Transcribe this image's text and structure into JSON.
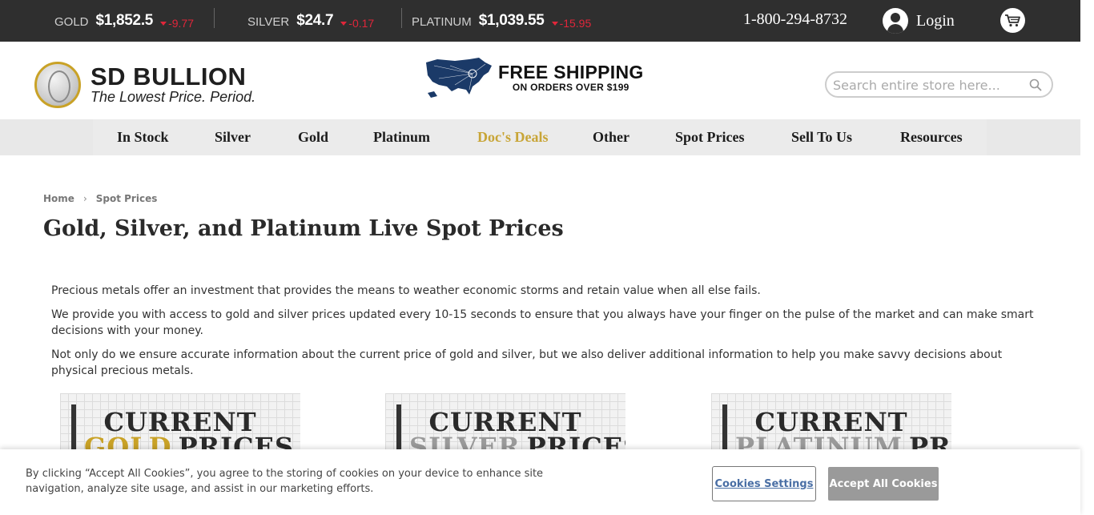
{
  "ticker": {
    "gold": {
      "label": "GOLD",
      "price": "$1,852.5",
      "change": "-9.77"
    },
    "silver": {
      "label": "SILVER",
      "price": "$24.7",
      "change": "-0.17"
    },
    "platinum": {
      "label": "PLATINUM",
      "price": "$1,039.55",
      "change": "-15.95"
    },
    "phone": "1-800-294-8732",
    "login": "Login"
  },
  "header": {
    "logo_name": "SD BULLION",
    "logo_tagline": "The Lowest Price. Period.",
    "promo_line1": "FREE SHIPPING",
    "promo_line2": "ON ORDERS OVER $199",
    "search_placeholder": "Search entire store here..."
  },
  "nav": {
    "items": [
      "In Stock",
      "Silver",
      "Gold",
      "Platinum",
      "Doc's Deals",
      "Other",
      "Spot Prices",
      "Sell To Us",
      "Resources"
    ]
  },
  "breadcrumb": {
    "home": "Home",
    "current": "Spot Prices"
  },
  "page_title": "Gold, Silver, and Platinum Live Spot Prices",
  "paragraphs": [
    "Precious metals offer an investment that provides the means to weather economic storms and retain value when all else fails.",
    "We provide you with access to gold and silver prices updated every 10-15 seconds to ensure that you always have your finger on the pulse of the market and can make smart decisions with your money.",
    "Not only do we ensure accurate information about the current price of gold and silver, but we also deliver additional information to help you make savvy decisions about physical precious metals."
  ],
  "cards": [
    {
      "line1": "CURRENT",
      "metal": "GOLD",
      "rest": "PRICES",
      "metal_color": "#c9a227"
    },
    {
      "line1": "CURRENT",
      "metal": "SILVER",
      "rest": "PRICES",
      "metal_color": "#9a9a9a"
    },
    {
      "line1": "CURRENT",
      "metal": "PLATINUM",
      "rest": "PRICES",
      "metal_color": "#9a9a9a"
    }
  ],
  "cookie": {
    "message": "By clicking “Accept All Cookies”, you agree to the storing of cookies on your device to enhance site navigation, analyze site usage, and assist in our marketing efforts.",
    "settings_label": "Cookies Settings",
    "accept_label": "Accept All Cookies"
  },
  "colors": {
    "ticker_bg": "#2f2f2f",
    "price_down": "#e0263a",
    "deal_gold": "#c8a537",
    "nav_bg": "#e8e8e8"
  }
}
